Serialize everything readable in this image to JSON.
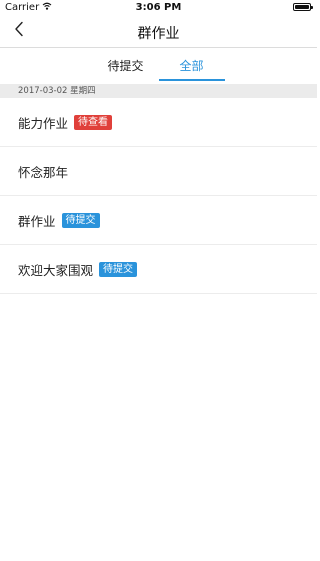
{
  "status_bar": {
    "carrier": "Carrier",
    "time": "3:06 PM",
    "wifi_icon": "wifi-icon",
    "battery_icon": "battery-icon"
  },
  "nav": {
    "title": "群作业",
    "back_icon": "chevron-left-icon"
  },
  "tabs": [
    {
      "label": "待提交",
      "active": false
    },
    {
      "label": "全部",
      "active": true
    }
  ],
  "date_header": "2017-03-02 星期四",
  "items": [
    {
      "title": "能力作业",
      "badge": "待查看",
      "badge_color": "#e0403a"
    },
    {
      "title": "怀念那年",
      "badge": null,
      "badge_color": null
    },
    {
      "title": "群作业",
      "badge": "待提交",
      "badge_color": "#2a93db"
    },
    {
      "title": "欢迎大家围观",
      "badge": "待提交",
      "badge_color": "#2a93db"
    }
  ],
  "colors": {
    "accent": "#2a93db",
    "badge_red": "#e0403a",
    "date_header_bg": "#ebebeb"
  }
}
